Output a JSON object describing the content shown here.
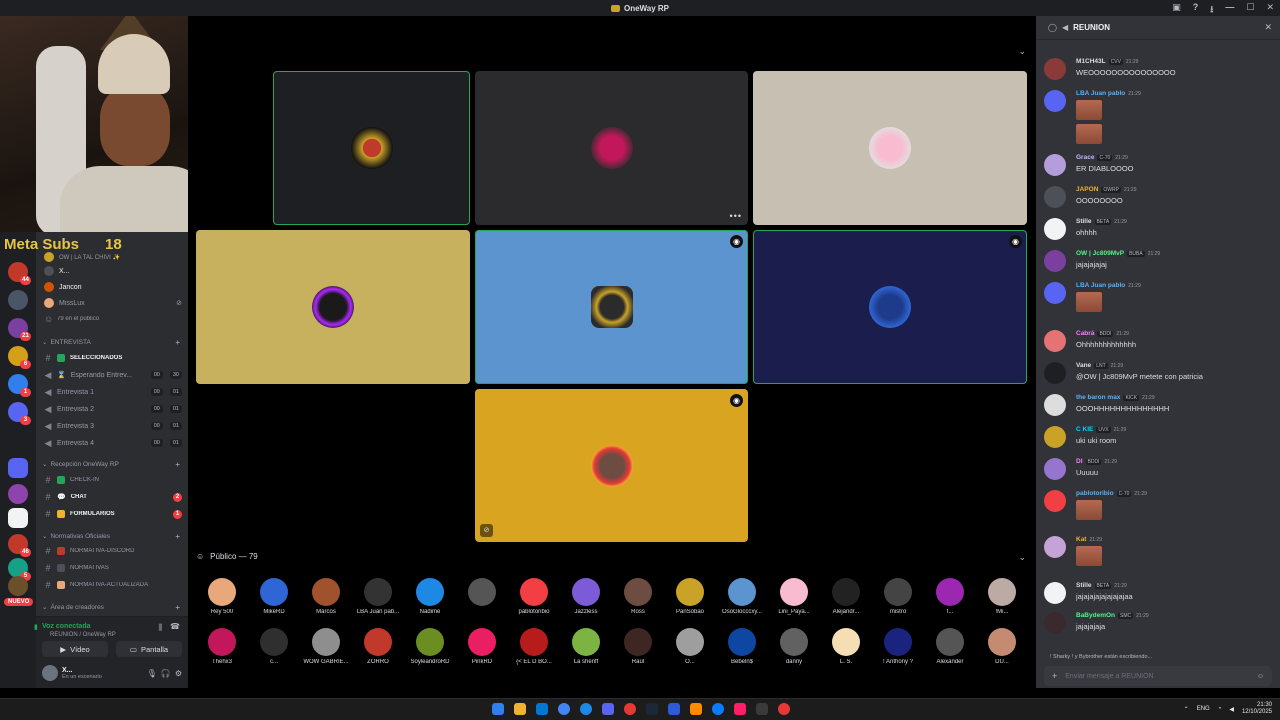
{
  "window": {
    "title": "OneWay RP"
  },
  "overlay": {
    "label": "Meta Subs",
    "value": "18"
  },
  "sidebar": {
    "top_items": [
      {
        "label": "OW | LA TAL CHIVI ✨"
      },
      {
        "label": "X..."
      },
      {
        "label": "Jancori"
      },
      {
        "label": "MissLux"
      },
      {
        "label": "79 en el público"
      }
    ],
    "categories": [
      {
        "label": "ENTREVISTA"
      },
      {
        "label": "Recepción OneWay RP"
      },
      {
        "label": "Normativas Oficiales"
      },
      {
        "label": "Área de creadores"
      }
    ],
    "channels": [
      {
        "label": "SELECCIONADOS"
      },
      {
        "label": "Esperando Entrev...",
        "p1": "00",
        "p2": "30"
      },
      {
        "label": "Entrevista 1",
        "p1": "00",
        "p2": "01"
      },
      {
        "label": "Entrevista 2",
        "p1": "00",
        "p2": "01"
      },
      {
        "label": "Entrevista 3",
        "p1": "00",
        "p2": "01"
      },
      {
        "label": "Entrevista 4",
        "p1": "00",
        "p2": "01"
      },
      {
        "label": "CHECK-IN"
      },
      {
        "label": "CHAT",
        "badge": "2"
      },
      {
        "label": "FORMULARIOS",
        "badge": "1"
      },
      {
        "label": "NORMATIVA-DISCORD"
      },
      {
        "label": "NORMATIVAS"
      },
      {
        "label": "NORMATIVA-ACTUALIZADA"
      }
    ],
    "voice": {
      "status": "Voz conectada",
      "channel": "REUNION / OneWay RP",
      "video_label": "Vídeo",
      "screen_label": "Pantalla"
    },
    "user": {
      "name": "X...",
      "status": "En un escenario"
    },
    "rail_badges": [
      "44",
      "21",
      "6",
      "1",
      "3",
      "46",
      "5"
    ],
    "new_label": "NUEVO"
  },
  "audience": {
    "header": "Público — 79",
    "members": [
      "Rey 500",
      "MikeRD",
      "Marcos",
      "LBA Juan pab...",
      "Nadime",
      "",
      "pablotoribio",
      "Jazzless",
      "Ross",
      "PanSobao",
      "OsoGlocccxy...",
      "Lini_Paya...",
      "Alejandr...",
      "mistro",
      "f...",
      "!Mi...",
      "Thehx3",
      "c...",
      "WOW GABRIE...",
      "ZORRO",
      "SoyleandroRD",
      "PinkRD",
      "{< EL D BO...",
      "La sheriff",
      "Raúl",
      "O...",
      "Bebeln$",
      "danny",
      "L. S.",
      "! Anthony ?",
      "Alexander",
      "DU..."
    ]
  },
  "chat": {
    "channel": "REUNION",
    "messages": [
      {
        "user": "M1CH43L",
        "tag": "CVV",
        "time": "21:29",
        "text": "WEOOOOOOOOOOOOOOO",
        "color": "#dbdee1"
      },
      {
        "user": "LBA Juan pablo",
        "tag": "",
        "time": "21:29",
        "text": "",
        "color": "#5db0f3"
      },
      {
        "user": "Grace",
        "tag": "C-70",
        "time": "21:29",
        "text": "ER DIABLOOOO",
        "color": "#c4b5fd"
      },
      {
        "user": "JAPON",
        "tag": "OWRP",
        "time": "21:29",
        "text": "OOOOOOOO",
        "color": "#f0b232"
      },
      {
        "user": "Stille",
        "tag": "BETA",
        "time": "21:29",
        "text": "ohhhh",
        "color": "#dbdee1"
      },
      {
        "user": "OW | Jc809MvP",
        "tag": "BUBA",
        "time": "21:29",
        "text": "jajajajajaj",
        "color": "#57f287"
      },
      {
        "user": "LBA Juan pablo",
        "tag": "",
        "time": "21:29",
        "text": "",
        "color": "#5db0f3"
      },
      {
        "user": "Cabrá",
        "tag": "BDDI",
        "time": "21:29",
        "text": "Ohhhhhhhhhhhhh",
        "color": "#f47fff"
      },
      {
        "user": "Vane",
        "tag": "LNT",
        "time": "21:29",
        "text": "@OW | Jc809MvP metete con patricia",
        "color": "#dbdee1"
      },
      {
        "user": "the baron max",
        "tag": "KICK",
        "time": "21:29",
        "text": "OOOHHHHHHHHHHHHHH",
        "color": "#5db0f3"
      },
      {
        "user": "C KIE",
        "tag": "UVX",
        "time": "21:29",
        "text": "uki uki room",
        "color": "#00d5ff"
      },
      {
        "user": "DI",
        "tag": "BDDI",
        "time": "21:29",
        "text": "Uuuuu",
        "color": "#f47fff"
      },
      {
        "user": "pablotoribio",
        "tag": "C-70",
        "time": "21:29",
        "text": "",
        "color": "#5db0f3"
      },
      {
        "user": "Kat",
        "tag": "",
        "time": "21:29",
        "text": "",
        "color": "#f0b232"
      },
      {
        "user": "Stille",
        "tag": "BETA",
        "time": "21:29",
        "text": "jajajajajajajajajaa",
        "color": "#dbdee1"
      },
      {
        "user": "BaBydemOn",
        "tag": "SMC",
        "time": "21:29",
        "text": "jajajajaja",
        "color": "#57f287"
      }
    ],
    "typing": "! Sharky ! y Bybrother están escribiendo...",
    "input_placeholder": "Enviar mensaje a REUNION"
  },
  "taskbar": {
    "lang": "ENG",
    "time": "21:30",
    "date": "12/10/2025"
  },
  "colors": {
    "accent": "#23a55a",
    "danger": "#f23f43",
    "panel": "#313338",
    "sidebar": "#2b2d31"
  }
}
